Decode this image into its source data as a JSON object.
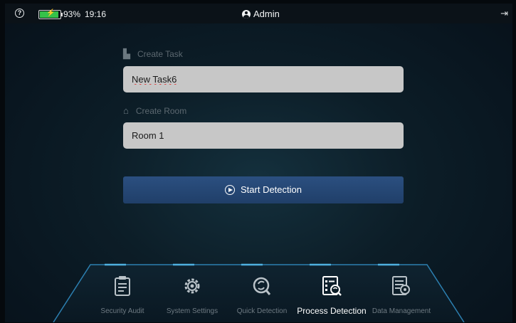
{
  "status_bar": {
    "battery_percent": "93%",
    "battery_level": 0.93,
    "time": "19:16",
    "user": "Admin"
  },
  "form": {
    "task_label": "Create Task",
    "task_value": "New Task6",
    "room_label": "Create Room",
    "room_value": "Room 1",
    "start_button": "Start Detection"
  },
  "nav": [
    {
      "label": "Security Audit",
      "icon": "clipboard-icon",
      "active": false
    },
    {
      "label": "System Settings",
      "icon": "gear-icon",
      "active": false
    },
    {
      "label": "Quick Detection",
      "icon": "scan-icon",
      "active": false
    },
    {
      "label": "Process Detection",
      "icon": "process-list-icon",
      "active": true
    },
    {
      "label": "Data Management",
      "icon": "data-search-icon",
      "active": false
    }
  ],
  "colors": {
    "accent_button": "#2b4f80",
    "battery": "#35c24a",
    "nav_line": "#2c7fb0"
  }
}
